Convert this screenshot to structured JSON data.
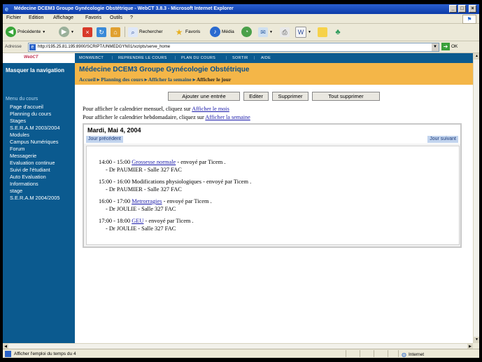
{
  "window": {
    "title": "Médecine DCEM3 Groupe Gynécologie Obstétrique - WebCT 3.8.3 - Microsoft Internet Explorer",
    "min_glyph": "_",
    "max_glyph": "□",
    "close_glyph": "×"
  },
  "menubar": {
    "items": [
      "Fichier",
      "Edition",
      "Affichage",
      "Favoris",
      "Outils",
      "?"
    ]
  },
  "toolbar": {
    "back_label": "Précédente",
    "search_label": "Rechercher",
    "favorites_label": "Favoris",
    "media_label": "Média"
  },
  "address": {
    "label": "Adresse",
    "url": "http://195.25.81.195:8900/SCRIPT/UNMEDGYN01/scripts/serve_home",
    "go_label": "OK"
  },
  "sidebar": {
    "hide_nav": "Masquer la navigation",
    "menu_title": "Menu du cours",
    "items": [
      "Page d'accueil",
      "Planning du cours",
      "Stages",
      "S.E.R.A.M 2003/2004",
      "Modules",
      "Campus Numériques",
      "Forum",
      "Messagerie",
      "Evaluation continue",
      "Suivi de l'étudiant",
      "Auto Evaluation",
      "Informations",
      "stage",
      "S.E.R.A.M 2004/2005"
    ]
  },
  "topnav": {
    "items": [
      "MONWEBCT",
      "REPRENDRE LE COURS",
      "PLAN DU COURS",
      "SORTIR",
      "AIDE"
    ]
  },
  "header": {
    "title": "Médecine DCEM3 Groupe Gynécologie Obstétrique",
    "breadcrumb": [
      "Accueil",
      "Planning des cours",
      "Afficher la semaine",
      "Afficher le jour"
    ]
  },
  "buttons": {
    "add": "Ajouter une entrée",
    "edit": "Editer",
    "delete": "Supprimer",
    "delete_all": "Tout supprimer"
  },
  "info": {
    "month_text": "Pour afficher le calendrier mensuel, cliquez sur ",
    "month_link": "Afficher le mois",
    "week_text": "Pour afficher le calendrier hebdomadaire, cliquez sur ",
    "week_link": "Afficher la semaine"
  },
  "calendar": {
    "date": "Mardi, Mai 4, 2004",
    "prev_day": "Jour précédent",
    "next_day": "Jour suivant",
    "events": [
      {
        "time": "14:00 - 15:00 ",
        "title": "Grossesse normale",
        "sender": " - envoyé par Ticem .",
        "detail": "- Dr PAUMIER - Salle 327 FAC",
        "linked": true
      },
      {
        "time": "15:00 - 16:00 ",
        "title": "Modifications physiologiques",
        "sender": " - envoyé par Ticem .",
        "detail": "- Dr PAUMIER - Salle 327 FAC",
        "linked": false
      },
      {
        "time": "16:00 - 17:00 ",
        "title": "Metrorragies",
        "sender": " - envoyé par Ticem .",
        "detail": "- Dr JOULIE - Salle 327 FAC",
        "linked": true
      },
      {
        "time": "17:00 - 18:00 ",
        "title": "GEU",
        "sender": " - envoyé par Ticem .",
        "detail": "- Dr JOULIE - Salle 327 FAC",
        "linked": true
      }
    ]
  },
  "status": {
    "text": "Afficher l'emploi du temps du 4",
    "zone": "Internet"
  },
  "colors": {
    "sidebar": "#0b5a8f",
    "header": "#f4b648",
    "link": "#1a1aaa",
    "titlebar": "#0a3aa8"
  }
}
